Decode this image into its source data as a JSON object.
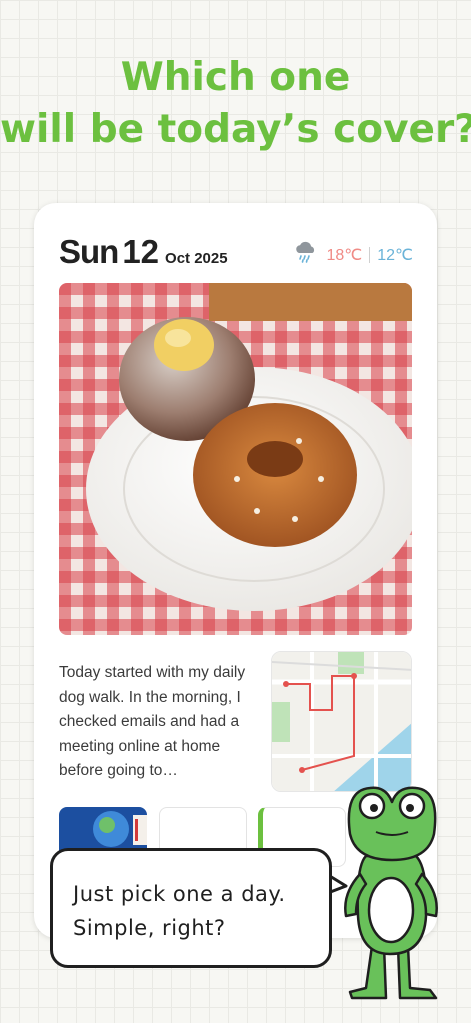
{
  "headline": {
    "line1": "Which one",
    "line2": "will be today’s cover?"
  },
  "card": {
    "day_of_week": "Sun",
    "day": "12",
    "month_year": "Oct 2025",
    "weather": {
      "icon": "rain-cloud-icon",
      "high": "18℃",
      "low": "12℃"
    },
    "photo": {
      "icon": "donuts-photo"
    },
    "entry_text": "Today started with my daily dog walk. In the morning, I checked emails and had a meeting online at home before going to…",
    "map": {
      "icon": "route-map"
    }
  },
  "bubble": {
    "line1": "Just pick one a day.",
    "line2": "Simple, right?"
  },
  "mascot": {
    "icon": "frog-mascot"
  },
  "colors": {
    "accent": "#6cc03f",
    "high_temp": "#f08b86",
    "low_temp": "#6ab3d8"
  }
}
